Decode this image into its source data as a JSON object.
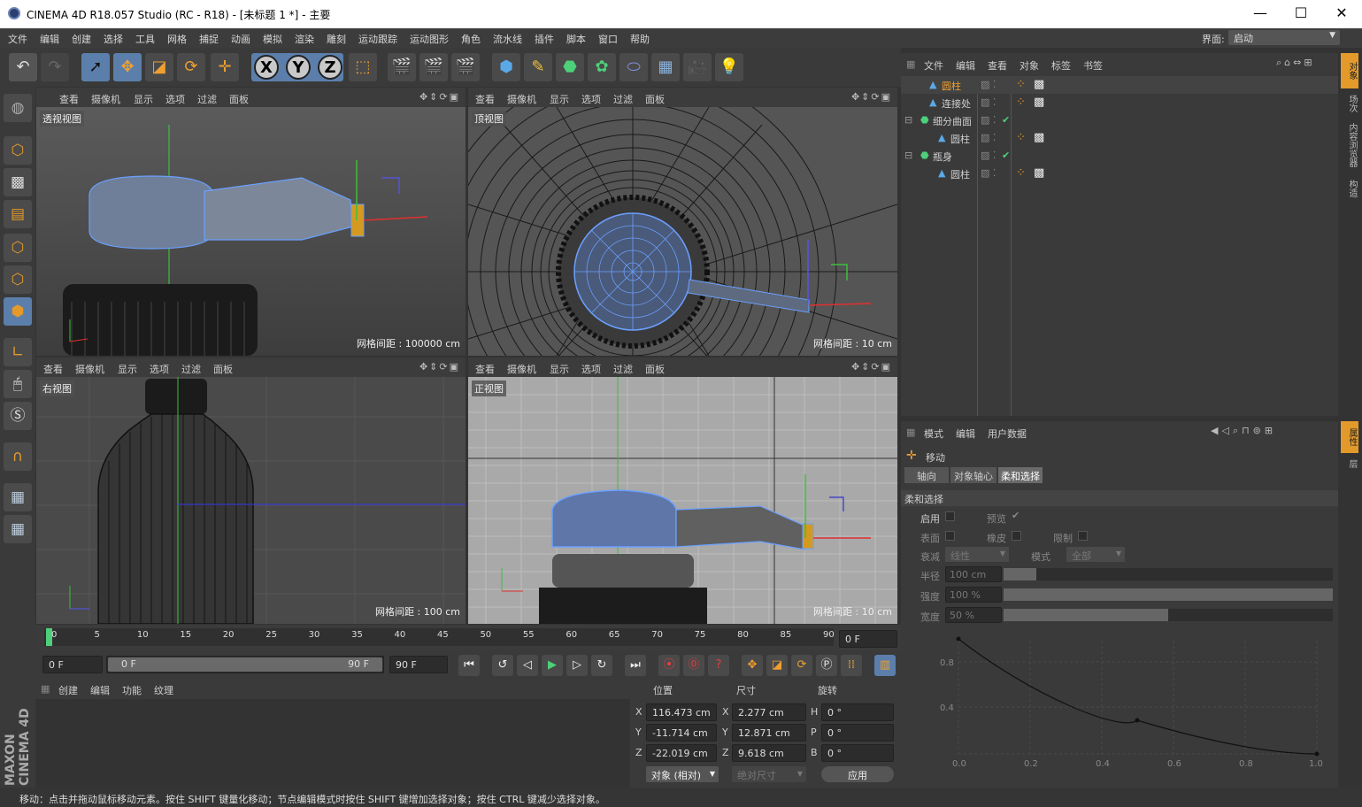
{
  "title": "CINEMA 4D R18.057 Studio (RC - R18) - [未标题 1 *] - 主要",
  "window_buttons": {
    "minimize": "—",
    "maximize": "☐",
    "close": "✕"
  },
  "menu": [
    "文件",
    "编辑",
    "创建",
    "选择",
    "工具",
    "网格",
    "捕捉",
    "动画",
    "模拟",
    "渲染",
    "雕刻",
    "运动跟踪",
    "运动图形",
    "角色",
    "流水线",
    "插件",
    "脚本",
    "窗口",
    "帮助"
  ],
  "layout": {
    "label": "界面:",
    "value": "启动"
  },
  "toolbar": {
    "undo": "↶",
    "redo": "↷",
    "axes": [
      "X",
      "Y",
      "Z"
    ]
  },
  "viewport_menu": [
    "查看",
    "摄像机",
    "显示",
    "选项",
    "过滤",
    "面板"
  ],
  "viewports": [
    {
      "label": "透视视图",
      "grid": "网格间距 : 100000 cm"
    },
    {
      "label": "顶视图",
      "grid": "网格间距 : 10 cm"
    },
    {
      "label": "右视图",
      "grid": "网格间距 : 100 cm"
    },
    {
      "label": "正视图",
      "grid": "网格间距 : 10 cm"
    }
  ],
  "timeline": {
    "ticks": [
      "0",
      "5",
      "10",
      "15",
      "20",
      "25",
      "30",
      "35",
      "40",
      "45",
      "50",
      "55",
      "60",
      "65",
      "70",
      "75",
      "80",
      "85",
      "90"
    ],
    "current_frame": "0 F"
  },
  "transport": {
    "start": "0 F",
    "range_start": "0 F",
    "range_end": "90 F",
    "end": "90 F"
  },
  "material_menu": [
    "创建",
    "编辑",
    "功能",
    "纹理"
  ],
  "coords": {
    "headers": [
      "位置",
      "尺寸",
      "旋转"
    ],
    "rows": [
      {
        "axis": "X",
        "pos": "116.473 cm",
        "size_axis": "X",
        "size": "2.277 cm",
        "rot_axis": "H",
        "rot": "0 °"
      },
      {
        "axis": "Y",
        "pos": "-11.714 cm",
        "size_axis": "Y",
        "size": "12.871 cm",
        "rot_axis": "P",
        "rot": "0 °"
      },
      {
        "axis": "Z",
        "pos": "-22.019 cm",
        "size_axis": "Z",
        "size": "9.618 cm",
        "rot_axis": "B",
        "rot": "0 °"
      }
    ],
    "mode": "对象 (相对)",
    "size_mode": "绝对尺寸",
    "apply": "应用"
  },
  "object_menu": [
    "文件",
    "编辑",
    "查看",
    "对象",
    "标签",
    "书签"
  ],
  "objects": [
    {
      "name": "圆柱",
      "indent": 1,
      "selected": true,
      "highlight": true
    },
    {
      "name": "连接处",
      "indent": 1,
      "selected": false,
      "highlight": false
    },
    {
      "name": "细分曲面",
      "indent": 0,
      "selected": false,
      "highlight": false
    },
    {
      "name": "圆柱",
      "indent": 2,
      "selected": false,
      "highlight": false
    },
    {
      "name": "瓶身",
      "indent": 0,
      "selected": false,
      "highlight": false
    },
    {
      "name": "圆柱",
      "indent": 2,
      "selected": false,
      "highlight": false
    }
  ],
  "attr_menu": [
    "模式",
    "编辑",
    "用户数据"
  ],
  "attr": {
    "tool": "移动",
    "tabs": [
      "轴向",
      "对象轴心",
      "柔和选择"
    ],
    "section": "柔和选择",
    "enable": "启用",
    "preview": "预览",
    "surface": "表面",
    "rubber": "橡皮",
    "restrict": "限制",
    "falloff": "衰减",
    "falloff_val": "线性",
    "mode": "模式",
    "mode_val": "全部",
    "radius": "半径",
    "radius_val": "100 cm",
    "strength": "强度",
    "strength_val": "100 %",
    "width": "宽度",
    "width_val": "50 %",
    "strength_fill": 1.0,
    "width_fill": 0.5,
    "radius_fill": 0.1,
    "curve_y_ticks": [
      "0.8",
      "0.4"
    ],
    "curve_x_ticks": [
      "0.0",
      "0.2",
      "0.4",
      "0.6",
      "0.8",
      "1.0"
    ]
  },
  "right_tabs": [
    "对象",
    "场次",
    "内容浏览器",
    "构造",
    "属性",
    "层"
  ],
  "status": "移动：点击并拖动鼠标移动元素。按住 SHIFT 键量化移动；节点编辑模式时按住 SHIFT 键增加选择对象；按住 CTRL 键减少选择对象。",
  "brand": "MAXON CINEMA 4D",
  "colors": {
    "accent": "#e39a2a",
    "selection": "#5b7faa",
    "mesh": "#6aa0ff"
  }
}
